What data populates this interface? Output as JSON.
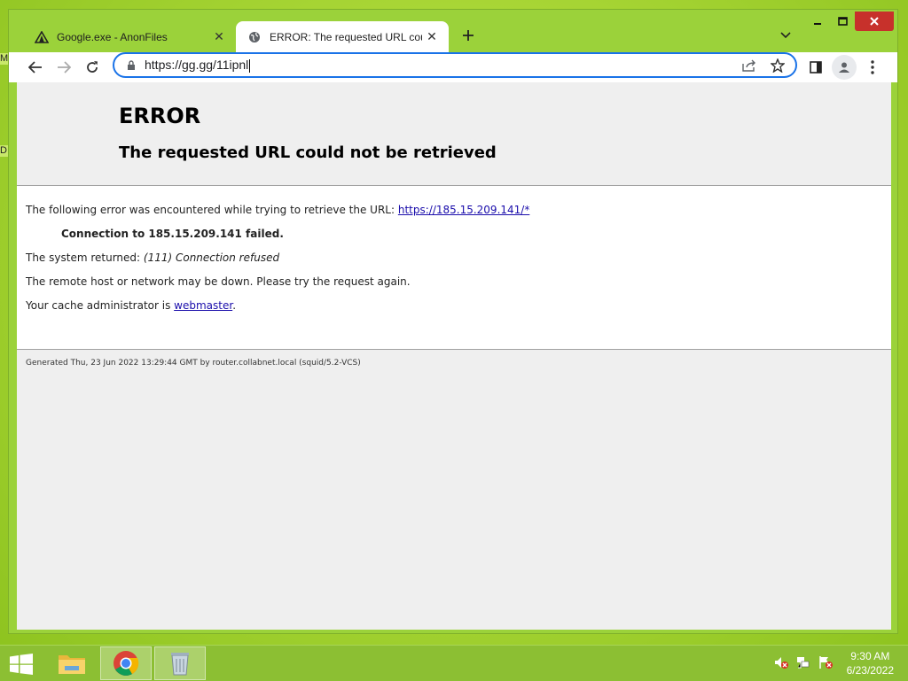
{
  "desktop": {
    "edge_labels": [
      "M",
      "D"
    ]
  },
  "browser": {
    "tabs": [
      {
        "title": "Google.exe - AnonFiles",
        "icon": "anonfiles-icon",
        "active": false
      },
      {
        "title": "ERROR: The requested URL could",
        "icon": "globe-icon",
        "active": true
      }
    ],
    "address": {
      "url": "https://gg.gg/11ipnl"
    }
  },
  "page": {
    "heading": "ERROR",
    "subheading": "The requested URL could not be retrieved",
    "intro_text": "The following error was encountered while trying to retrieve the URL: ",
    "intro_link": "https://185.15.209.141/*",
    "failed_text": "Connection to 185.15.209.141 failed.",
    "system_prefix": "The system returned: ",
    "system_value": "(111) Connection refused",
    "remote_text": "The remote host or network may be down. Please try the request again.",
    "cache_prefix": "Your cache administrator is ",
    "cache_link": "webmaster",
    "cache_suffix": ".",
    "footer": "Generated Thu, 23 Jun 2022 13:29:44 GMT by router.collabnet.local (squid/5.2-VCS)"
  },
  "taskbar": {
    "time": "9:30 AM",
    "date": "6/23/2022"
  },
  "colors": {
    "accent": "#1a73e8",
    "close_button": "#c7312b",
    "link": "#1a0dab"
  }
}
